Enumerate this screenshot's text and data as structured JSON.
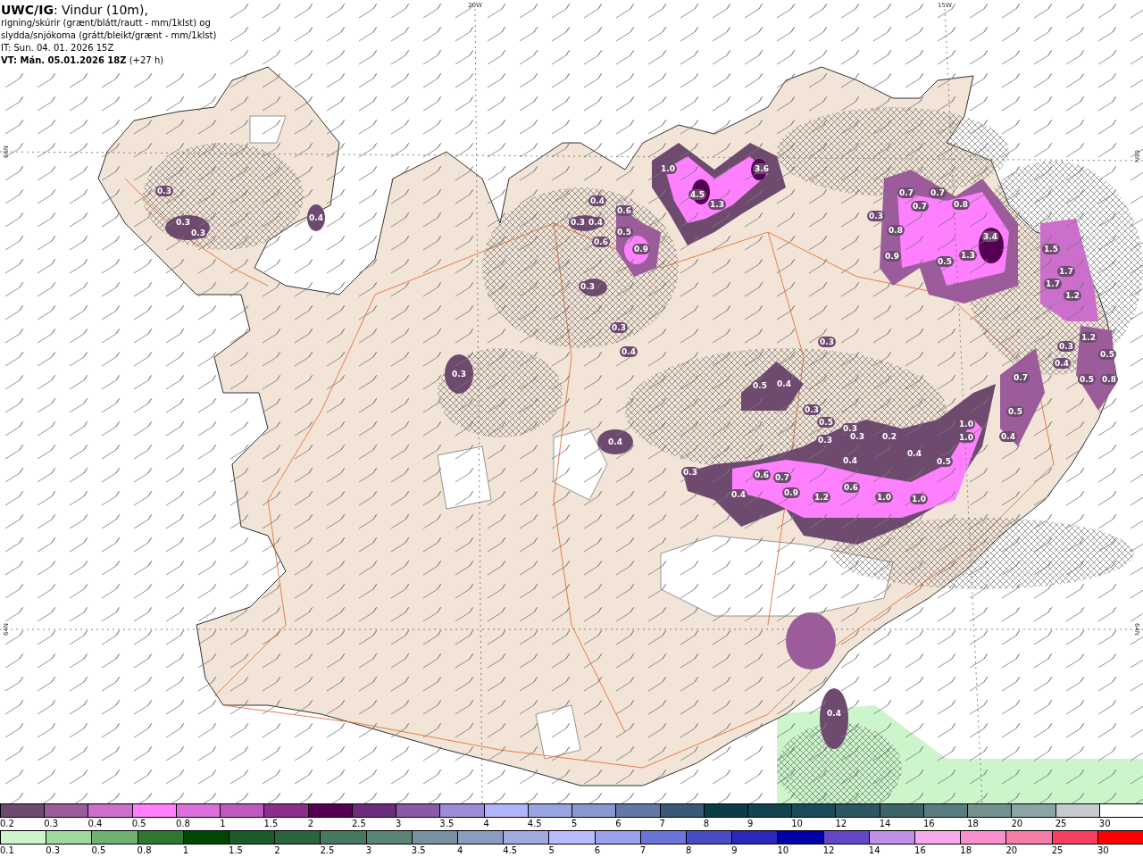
{
  "header": {
    "lines": [
      "**UWC/IG**: Vindur (10m),",
      "rigning/skúrir (grænt/blátt/rautt - mm/1klst) og",
      "slydda/snjókoma (grátt/bleikt/grænt - mm/1klst)",
      "IT: Sun. 04. 01. 2026 15Z",
      "**VT: Mán. 05.01.2026 18Z** (+27 h)"
    ]
  },
  "map": {
    "axis_labels": [
      "20W",
      "15W",
      "66N",
      "66N",
      "64N",
      "64N"
    ],
    "value_labels": [
      "0.3",
      "0.3",
      "0.3",
      "0.4",
      "0.3",
      "1.0",
      "4.5",
      "1.3",
      "3.6",
      "0.4",
      "0.3",
      "0.4",
      "0.6",
      "0.5",
      "0.6",
      "0.9",
      "0.3",
      "0.3",
      "0.4",
      "0.3",
      "0.7",
      "0.7",
      "0.7",
      "0.8",
      "0.3",
      "0.8",
      "0.9",
      "0.5",
      "1.3",
      "3.4",
      "1.5",
      "1.7",
      "1.7",
      "1.2",
      "1.2",
      "0.5",
      "0.3",
      "0.4",
      "0.7",
      "0.5",
      "0.8",
      "0.5",
      "0.4",
      "0.3",
      "0.5",
      "0.3",
      "0.3",
      "0.3",
      "0.2",
      "0.4",
      "0.4",
      "0.5",
      "1.0",
      "1.0",
      "0.4",
      "0.5",
      "0.3",
      "0.6",
      "0.7",
      "0.4",
      "0.9",
      "1.2",
      "0.6",
      "1.0",
      "1.0",
      "0.4",
      "0.4"
    ]
  },
  "legend": {
    "rows": [
      {
        "items": [
          {
            "label": "0.2",
            "color": "#6e4a6e"
          },
          {
            "label": "0.3",
            "color": "#9c5c9c"
          },
          {
            "label": "0.4",
            "color": "#cc6ecc"
          },
          {
            "label": "0.5",
            "color": "#ff80ff"
          },
          {
            "label": "0.8",
            "color": "#dd6edd"
          },
          {
            "label": "1",
            "color": "#c05ac0"
          },
          {
            "label": "1.5",
            "color": "#8c2e8c"
          },
          {
            "label": "2",
            "color": "#540054"
          },
          {
            "label": "2.5",
            "color": "#6c2c7c"
          },
          {
            "label": "3",
            "color": "#8a5aa8"
          },
          {
            "label": "3.5",
            "color": "#9c8cd8"
          },
          {
            "label": "4",
            "color": "#b0b4fa"
          },
          {
            "label": "4.5",
            "color": "#98a4e0"
          },
          {
            "label": "5",
            "color": "#8a96d0"
          },
          {
            "label": "6",
            "color": "#6478a8"
          },
          {
            "label": "7",
            "color": "#3c5878"
          },
          {
            "label": "8",
            "color": "#0c3c48"
          },
          {
            "label": "9",
            "color": "#124450"
          },
          {
            "label": "10",
            "color": "#1c4a58"
          },
          {
            "label": "12",
            "color": "#2c5660"
          },
          {
            "label": "14",
            "color": "#3e6468"
          },
          {
            "label": "16",
            "color": "#587c80"
          },
          {
            "label": "18",
            "color": "#74908e"
          },
          {
            "label": "20",
            "color": "#8ca4a4"
          },
          {
            "label": "25",
            "color": "#c4ccd0"
          },
          {
            "label": "30",
            "color": "#ffffff"
          }
        ]
      },
      {
        "items": [
          {
            "label": "0.1",
            "color": "#ccf5cc"
          },
          {
            "label": "0.3",
            "color": "#a0d8a0"
          },
          {
            "label": "0.5",
            "color": "#70b070"
          },
          {
            "label": "0.8",
            "color": "#307830"
          },
          {
            "label": "1",
            "color": "#004800"
          },
          {
            "label": "1.5",
            "color": "#1c5a28"
          },
          {
            "label": "2",
            "color": "#2c6440"
          },
          {
            "label": "2.5",
            "color": "#487860"
          },
          {
            "label": "3",
            "color": "#5a8478"
          },
          {
            "label": "3.5",
            "color": "#7890a0"
          },
          {
            "label": "4",
            "color": "#8c9cc0"
          },
          {
            "label": "4.5",
            "color": "#a0aae0"
          },
          {
            "label": "5",
            "color": "#b8bcfc"
          },
          {
            "label": "6",
            "color": "#9aa0ec"
          },
          {
            "label": "7",
            "color": "#6c74d8"
          },
          {
            "label": "8",
            "color": "#4a4cc4"
          },
          {
            "label": "9",
            "color": "#2c28bc"
          },
          {
            "label": "10",
            "color": "#0000a8"
          },
          {
            "label": "12",
            "color": "#6448c8"
          },
          {
            "label": "14",
            "color": "#c090e8"
          },
          {
            "label": "16",
            "color": "#f8a8ec"
          },
          {
            "label": "18",
            "color": "#f890cc"
          },
          {
            "label": "20",
            "color": "#f87ca8"
          },
          {
            "label": "25",
            "color": "#f84060"
          },
          {
            "label": "30",
            "color": "#ff0000"
          }
        ]
      }
    ]
  }
}
